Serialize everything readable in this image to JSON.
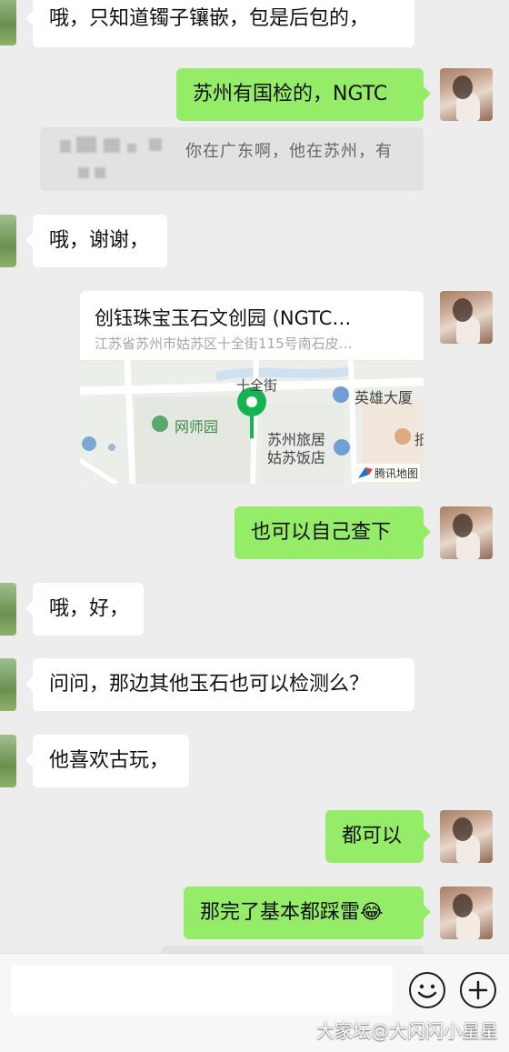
{
  "messages": [
    {
      "side": "left",
      "text": "哦，只知道镯子镶嵌，包是后包的，"
    },
    {
      "side": "right",
      "text": "苏州有国检的，NGTC"
    },
    {
      "side": "quote",
      "text": "你在广东啊，他在苏州，有"
    },
    {
      "side": "left",
      "text": "哦，谢谢，"
    },
    {
      "side": "right",
      "text": "也可以自己查下"
    },
    {
      "side": "left",
      "text": "哦，好，"
    },
    {
      "side": "left",
      "text": "问问，那边其他玉石也可以检测么？"
    },
    {
      "side": "left",
      "text": "他喜欢古玩，"
    },
    {
      "side": "right",
      "text": "都可以"
    },
    {
      "side": "right",
      "text": "那完了基本都踩雷"
    }
  ],
  "emoji": "😂",
  "location_card": {
    "title": "创钰珠宝玉石文创园 (NGTC…",
    "address": "江苏省苏州市姑苏区十全街115号南石皮…",
    "map": {
      "street": "十全街",
      "poi_1": "英雄大厦",
      "poi_2": "网师园",
      "poi_3": "苏州旅居",
      "poi_4": "姑苏饭店",
      "poi_5": "抵",
      "provider": "腾讯地图",
      "pin_color": "#16b353"
    }
  },
  "input_bar": {
    "emoji_icon": "smile-icon",
    "plus_icon": "plus-icon"
  },
  "watermark": "大家坛@大闪闪小星星",
  "colors": {
    "background": "#ededed",
    "bubble_right": "#95ec69",
    "bubble_left": "#ffffff"
  }
}
